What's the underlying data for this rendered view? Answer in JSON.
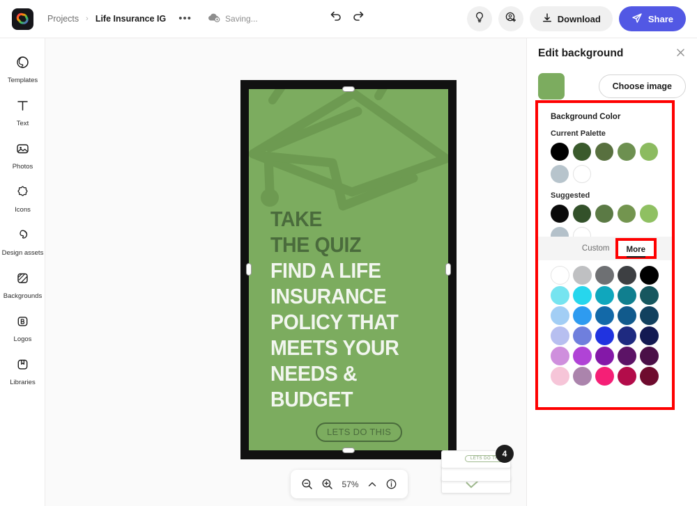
{
  "topbar": {
    "logo_icon": "adobe-express-logo",
    "breadcrumb_projects": "Projects",
    "breadcrumb_separator": "›",
    "breadcrumb_title": "Life Insurance IG",
    "more_options": "•••",
    "cloud_icon": "cloud-sync-icon",
    "saving_status": "Saving...",
    "undo_icon": "undo-icon",
    "redo_icon": "redo-icon",
    "ideas_icon": "lightbulb-icon",
    "add_account_icon": "add-account-icon",
    "download_icon": "download-icon",
    "download_label": "Download",
    "share_icon": "send-icon",
    "share_label": "Share",
    "share_color": "#5258e4"
  },
  "sidebar": {
    "items": [
      {
        "label": "Templates",
        "icon": "templates-icon"
      },
      {
        "label": "Text",
        "icon": "text-icon"
      },
      {
        "label": "Photos",
        "icon": "photos-icon"
      },
      {
        "label": "Icons",
        "icon": "icons-icon"
      },
      {
        "label": "Design assets",
        "icon": "design-assets-icon"
      },
      {
        "label": "Backgrounds",
        "icon": "backgrounds-icon"
      },
      {
        "label": "Logos",
        "icon": "logos-icon"
      },
      {
        "label": "Libraries",
        "icon": "libraries-icon"
      }
    ]
  },
  "canvas": {
    "background_color": "#7cac5f",
    "frame_color": "#111111",
    "graphic": "graduation-cap-illustration",
    "headline_dark": [
      "TAKE",
      "THE QUIZ"
    ],
    "headline_light": [
      "FIND A LIFE",
      "INSURANCE",
      "POLICY THAT",
      "MEETS YOUR",
      "NEEDS &",
      "BUDGET"
    ],
    "cta_label": "LETS DO THIS",
    "dark_text_color": "#4a6b3c",
    "light_text_color": "#f2f6ef",
    "page_badge_count": "4",
    "page_thumb_cta": "LETS DO THIS"
  },
  "zoombar": {
    "zoom_out_icon": "zoom-out-icon",
    "zoom_in_icon": "zoom-in-icon",
    "zoom_level": "57%",
    "chevron_icon": "chevron-up-icon",
    "info_icon": "info-icon"
  },
  "panel": {
    "title": "Edit background",
    "close_icon": "close-icon",
    "current_swatch_color": "#7cac5f",
    "choose_image_label": "Choose image",
    "section_title": "Background Color",
    "current_palette_label": "Current Palette",
    "current_palette": [
      "#000000",
      "#3a5a2c",
      "#58703f",
      "#6d9050",
      "#8cbb60",
      "#b7c4cc",
      "#ffffff"
    ],
    "suggested_label": "Suggested",
    "suggested_palette": [
      "#0a0a0a",
      "#33512a",
      "#5b7a45",
      "#73954f",
      "#8fc062",
      "#b4c1ca",
      "#ffffff"
    ],
    "tab_custom": "Custom",
    "tab_more": "More",
    "active_tab": "More",
    "annotation_color": "#fe0000",
    "color_grid": [
      [
        "#ffffff",
        "#bfc0c2",
        "#6e7073",
        "#3d3f42",
        "#000000"
      ],
      [
        "#76e4f0",
        "#27d6ed",
        "#10a7bd",
        "#107f8f",
        "#16575f"
      ],
      [
        "#a2cef5",
        "#2e9bf0",
        "#1369a8",
        "#115a8c",
        "#12415f"
      ],
      [
        "#b7bff0",
        "#6f7fdd",
        "#2033e0",
        "#1e2a80",
        "#131a52"
      ],
      [
        "#cf8fdd",
        "#b043d6",
        "#8418a8",
        "#5c1366",
        "#4a0f47"
      ],
      [
        "#f6c5d8",
        "#ab84ac",
        "#f51f76",
        "#b30c4a",
        "#6e0b2e"
      ]
    ]
  }
}
